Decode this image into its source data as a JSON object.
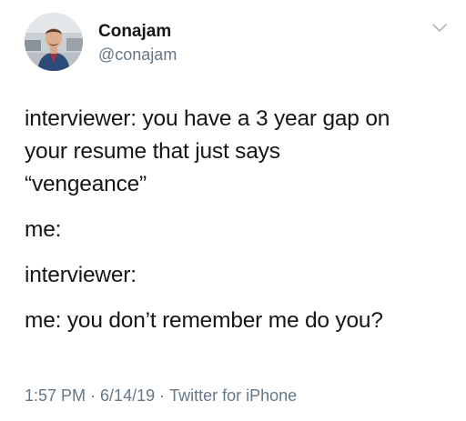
{
  "user": {
    "display_name": "Conajam",
    "handle": "@conajam"
  },
  "tweet": {
    "paragraphs": [
      [
        "interviewer: you have a 3 year gap on",
        "your resume that just says",
        "“vengeance”"
      ],
      [
        "me:"
      ],
      [
        "interviewer:"
      ],
      [
        "me: you don’t remember me do you?"
      ]
    ],
    "time": "1:57 PM",
    "date": "6/14/19",
    "separator": "·",
    "source": "Twitter for iPhone"
  },
  "icons": {
    "caret": "chevron-down-icon"
  },
  "colors": {
    "text": "#14171a",
    "secondary": "#657786",
    "background": "#ffffff"
  }
}
